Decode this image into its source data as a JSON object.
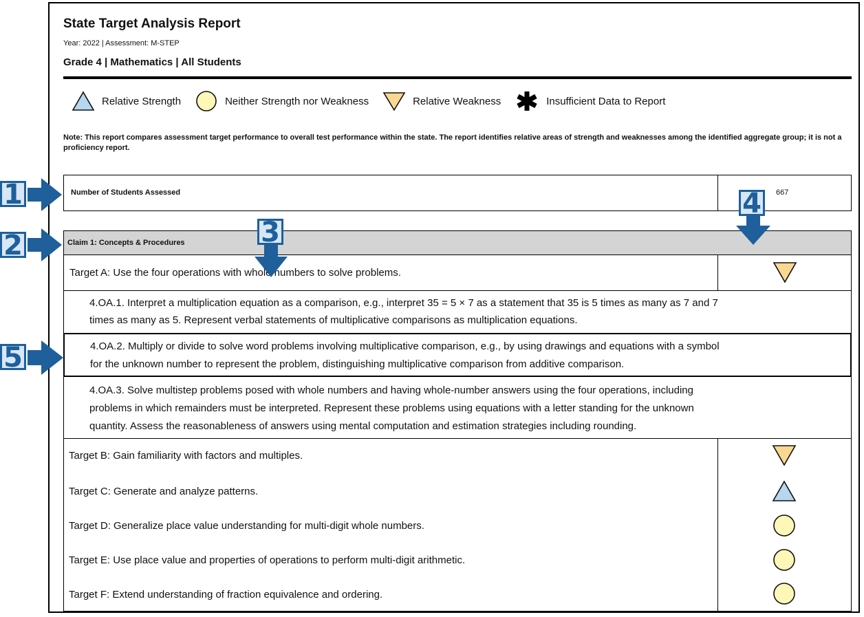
{
  "report": {
    "title": "State Target Analysis Report",
    "meta": "Year: 2022 | Assessment: M-STEP",
    "subtitle": "Grade 4 | Mathematics | All Students"
  },
  "legend": [
    {
      "icon": "triangle-up-icon",
      "label": "Relative Strength",
      "color": "#b6d6f2"
    },
    {
      "icon": "circle-icon",
      "label": "Neither Strength nor Weakness",
      "color": "#fdf8b8"
    },
    {
      "icon": "triangle-down-icon",
      "label": "Relative Weakness",
      "color": "#fbd891"
    },
    {
      "icon": "asterisk-icon",
      "label": "Insufficient Data to Report",
      "color": "#000000"
    }
  ],
  "note": "Note: This report compares assessment target performance to overall test performance within the state. The report identifies relative areas of strength and weaknesses among the identified aggregate group; it is not a proficiency report.",
  "students": {
    "label": "Number of Students Assessed",
    "value": "667"
  },
  "claim": {
    "label": "Claim 1: Concepts & Procedures"
  },
  "targetA": {
    "label": "Target A: Use the four operations with whole numbers to solve problems.",
    "indicator": "relative-weakness"
  },
  "standards": [
    {
      "lines": [
        "4.OA.1. Interpret a multiplication equation as a comparison, e.g., interpret 35 = 5 × 7 as a statement that 35 is 5 times as many as 7 and 7",
        "times as many as 5. Represent verbal statements of multiplicative comparisons as multiplication equations."
      ]
    },
    {
      "lines": [
        "4.OA.2. Multiply or divide to solve word problems involving multiplicative comparison, e.g., by using drawings and equations with a symbol",
        "for the unknown number to represent the problem, distinguishing multiplicative comparison from additive comparison."
      ]
    },
    {
      "lines": [
        "4.OA.3. Solve multistep problems posed with whole numbers and having whole-number answers using the four operations, including",
        "problems in which remainders must be interpreted. Represent these problems using equations with a letter standing for the unknown",
        "quantity. Assess the reasonableness of answers using mental computation and estimation strategies including rounding."
      ]
    }
  ],
  "targets": [
    {
      "label": "Target B: Gain familiarity with factors and multiples.",
      "indicator": "relative-weakness"
    },
    {
      "label": "Target C: Generate and analyze patterns.",
      "indicator": "relative-strength"
    },
    {
      "label": "Target D: Generalize place value understanding for multi-digit whole numbers.",
      "indicator": "neither"
    },
    {
      "label": "Target E: Use place value and properties of operations to perform multi-digit arithmetic.",
      "indicator": "neither"
    },
    {
      "label": "Target F: Extend understanding of fraction equivalence and ordering.",
      "indicator": "neither"
    }
  ],
  "callouts": [
    "1",
    "2",
    "3",
    "4",
    "5"
  ],
  "colors": {
    "callout": "#1f5f9b",
    "callout_fill": "#d7e7f6",
    "claim_bg": "#d4d4d4"
  }
}
